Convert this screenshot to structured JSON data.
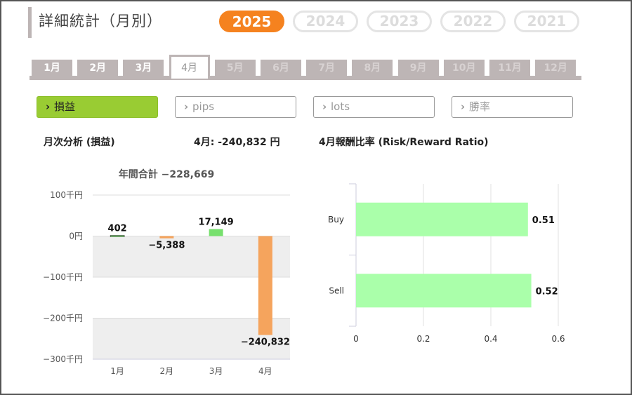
{
  "header": {
    "title": "詳細統計（月別）",
    "years": [
      {
        "label": "2025",
        "active": true
      },
      {
        "label": "2024",
        "active": false
      },
      {
        "label": "2023",
        "active": false
      },
      {
        "label": "2022",
        "active": false
      },
      {
        "label": "2021",
        "active": false
      }
    ]
  },
  "months": [
    {
      "label": "1月",
      "state": "enabled"
    },
    {
      "label": "2月",
      "state": "enabled"
    },
    {
      "label": "3月",
      "state": "enabled"
    },
    {
      "label": "4月",
      "state": "active"
    },
    {
      "label": "5月",
      "state": "disabled"
    },
    {
      "label": "6月",
      "state": "disabled"
    },
    {
      "label": "7月",
      "state": "disabled"
    },
    {
      "label": "8月",
      "state": "disabled"
    },
    {
      "label": "9月",
      "state": "disabled"
    },
    {
      "label": "10月",
      "state": "disabled"
    },
    {
      "label": "11月",
      "state": "disabled"
    },
    {
      "label": "12月",
      "state": "disabled"
    }
  ],
  "metrics": [
    {
      "label": "損益",
      "active": true
    },
    {
      "label": "pips",
      "active": false
    },
    {
      "label": "lots",
      "active": false
    },
    {
      "label": "勝率",
      "active": false
    }
  ],
  "chevron": "›",
  "left_section": {
    "title": "月次分析 (損益)",
    "month_value": "4月:  -240,832 円"
  },
  "right_section": {
    "title": "4月報酬比率 (Risk/Reward Ratio)"
  },
  "colors": {
    "accent_orange": "#f5821f",
    "tab_gray": "#bdb5b5",
    "button_green": "#99cc33",
    "bar_positive": "#77e06d",
    "bar_negative": "#f5a45d",
    "bar_ratio": "#aaffaa"
  },
  "chart_data": [
    {
      "type": "bar",
      "title": "年間合計 −228,669",
      "categories": [
        "1月",
        "2月",
        "3月",
        "4月"
      ],
      "values": [
        402,
        -5388,
        17149,
        -240832
      ],
      "data_labels": [
        "402",
        "−5,388",
        "17,149",
        "−240,832"
      ],
      "ylim": [
        -300000,
        100000
      ],
      "y_ticks": [
        100000,
        0,
        -100000,
        -200000,
        -300000
      ],
      "y_tick_labels": [
        "100千円",
        "0円",
        "−100千円",
        "−200千円",
        "−300千円"
      ],
      "grid": true
    },
    {
      "type": "bar",
      "orientation": "horizontal",
      "categories": [
        "Buy",
        "Sell"
      ],
      "values": [
        0.51,
        0.52
      ],
      "data_labels": [
        "0.51",
        "0.52"
      ],
      "xlim": [
        0,
        0.6
      ],
      "x_ticks": [
        0,
        0.2,
        0.4,
        0.6
      ],
      "x_tick_labels": [
        "0",
        "0.2",
        "0.4",
        "0.6"
      ],
      "grid": true
    }
  ]
}
